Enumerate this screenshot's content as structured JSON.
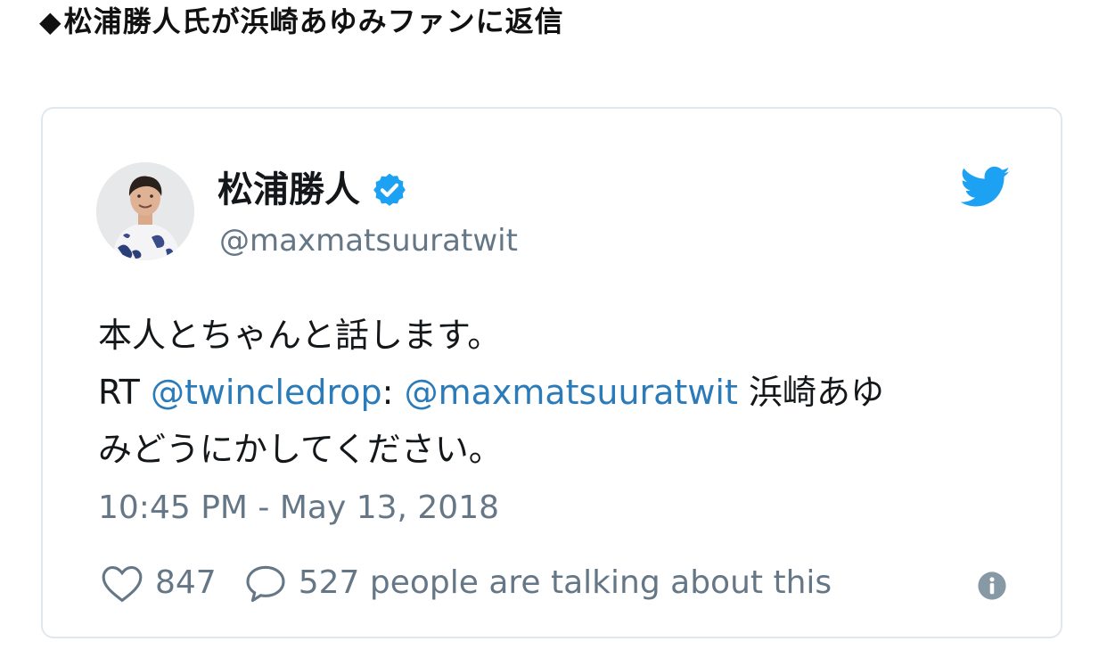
{
  "headline": {
    "marker": "◆",
    "text": "松浦勝人氏が浜崎あゆみファンに返信"
  },
  "tweet": {
    "author_name": "松浦勝人",
    "handle": "@maxmatsuuratwit",
    "text_line1": "本人とちゃんと話します。",
    "rt_prefix": "RT ",
    "rt_user": "@twincledrop",
    "rt_colon": ": ",
    "rt_mention": "@maxmatsuuratwit",
    "rt_text_a": " 浜崎あゆ",
    "rt_text_b": "みどうにかしてください。",
    "timestamp": "10:45 PM - May 13, 2018",
    "like_count": "847",
    "reply_text": "527 people are talking about this"
  },
  "icons": {
    "verified": "verified-badge-icon",
    "twitter": "twitter-bird-icon",
    "like": "heart-icon",
    "reply": "speech-bubble-icon",
    "info": "info-icon"
  },
  "colors": {
    "link": "#2b7bb9",
    "twitter_blue": "#1da1f2",
    "muted": "#657786",
    "border": "#e1e8ed"
  }
}
